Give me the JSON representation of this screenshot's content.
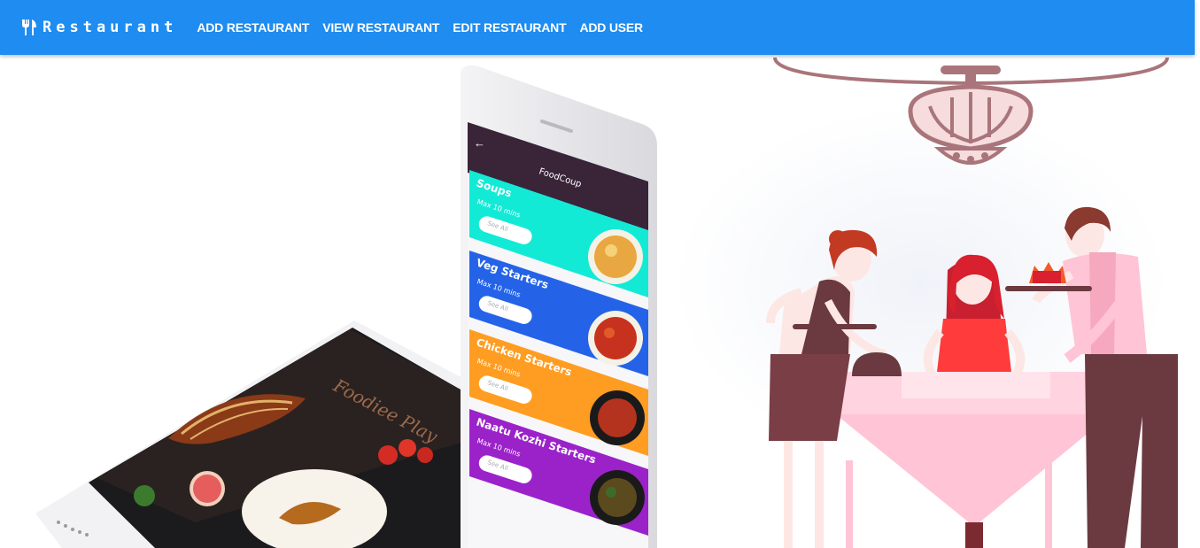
{
  "navbar": {
    "brand": "Restaurant",
    "links": [
      "ADD RESTAURANT",
      "VIEW RESTAURANT",
      "EDIT RESTAURANT",
      "ADD USER"
    ]
  },
  "hero": {
    "app_title": "FoodCoup",
    "cards": [
      {
        "title": "Soups",
        "subtitle": "Max 10 mins",
        "button": "See All",
        "color": "#12ead6"
      },
      {
        "title": "Veg Starters",
        "subtitle": "Max 10 mins",
        "button": "See All",
        "color": "#2463e8"
      },
      {
        "title": "Chicken Starters",
        "subtitle": "Max 10 mins",
        "button": "See All",
        "color": "#ff9d22"
      },
      {
        "title": "Naatu Kozhi Starters",
        "subtitle": "Max 10 mins",
        "button": "See All",
        "color": "#9b22c9"
      }
    ],
    "tablet_logo": "Foodiee Play"
  },
  "colors": {
    "navbar": "#1e8cf0",
    "chandelier": "#a9757a",
    "tablecloth": "#ffc4d6",
    "waiter_dress": "#6b3a40"
  }
}
